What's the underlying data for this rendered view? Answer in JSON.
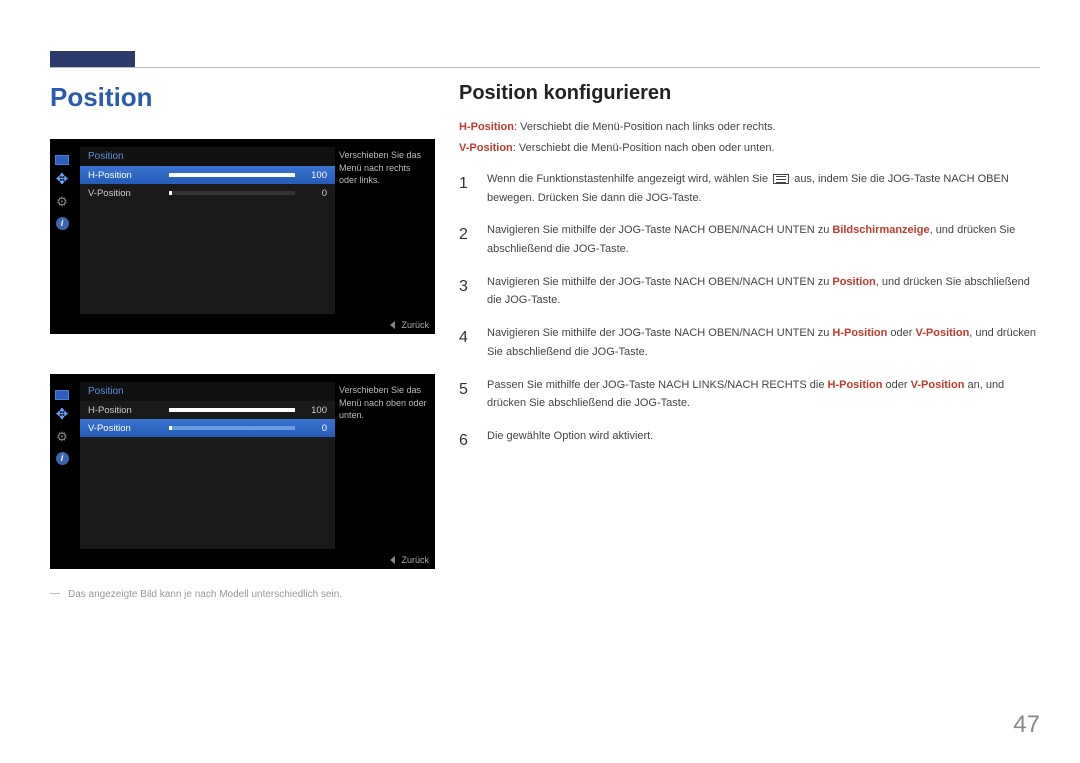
{
  "page_number": "47",
  "section_title": "Position",
  "subsection_title": "Position konfigurieren",
  "intro": {
    "h_label": "H-Position",
    "h_text": ": Verschiebt die Menü-Position nach links oder rechts.",
    "v_label": "V-Position",
    "v_text": ": Verschiebt die Menü-Position nach oben oder unten."
  },
  "steps": [
    {
      "pre": "Wenn die Funktionstastenhilfe angezeigt wird, wählen Sie ",
      "post": " aus, indem Sie die JOG-Taste NACH OBEN bewegen. Drücken Sie dann die JOG-Taste."
    },
    {
      "pre": "Navigieren Sie mithilfe der JOG-Taste NACH OBEN/NACH UNTEN zu ",
      "b1": "Bildschirmanzeige",
      "post": ", und drücken Sie abschließend die JOG-Taste."
    },
    {
      "pre": "Navigieren Sie mithilfe der JOG-Taste NACH OBEN/NACH UNTEN zu ",
      "b1": "Position",
      "post": ", und drücken Sie abschließend die JOG-Taste."
    },
    {
      "pre": "Navigieren Sie mithilfe der JOG-Taste NACH OBEN/NACH UNTEN zu ",
      "b1": "H-Position",
      "mid": " oder ",
      "b2": "V-Position",
      "post": ", und drücken Sie abschließend die JOG-Taste."
    },
    {
      "pre": "Passen Sie mithilfe der JOG-Taste NACH LINKS/NACH RECHTS die ",
      "b1": "H-Position",
      "mid": " oder ",
      "b2": "V-Position",
      "post": " an, und drücken Sie abschließend die JOG-Taste."
    },
    {
      "pre": "Die gewählte Option wird aktiviert."
    }
  ],
  "footnote": "Das angezeigte Bild kann je nach Modell unterschiedlich sein.",
  "osd": {
    "title": "Position",
    "rows": [
      {
        "label": "H-Position",
        "value": "100",
        "fill": 100
      },
      {
        "label": "V-Position",
        "value": "0",
        "fill": 0
      }
    ],
    "help1": "Verschieben Sie das Menü nach rechts oder links.",
    "help2": "Verschieben Sie das Menü nach oben oder unten.",
    "back": "Zurück"
  }
}
